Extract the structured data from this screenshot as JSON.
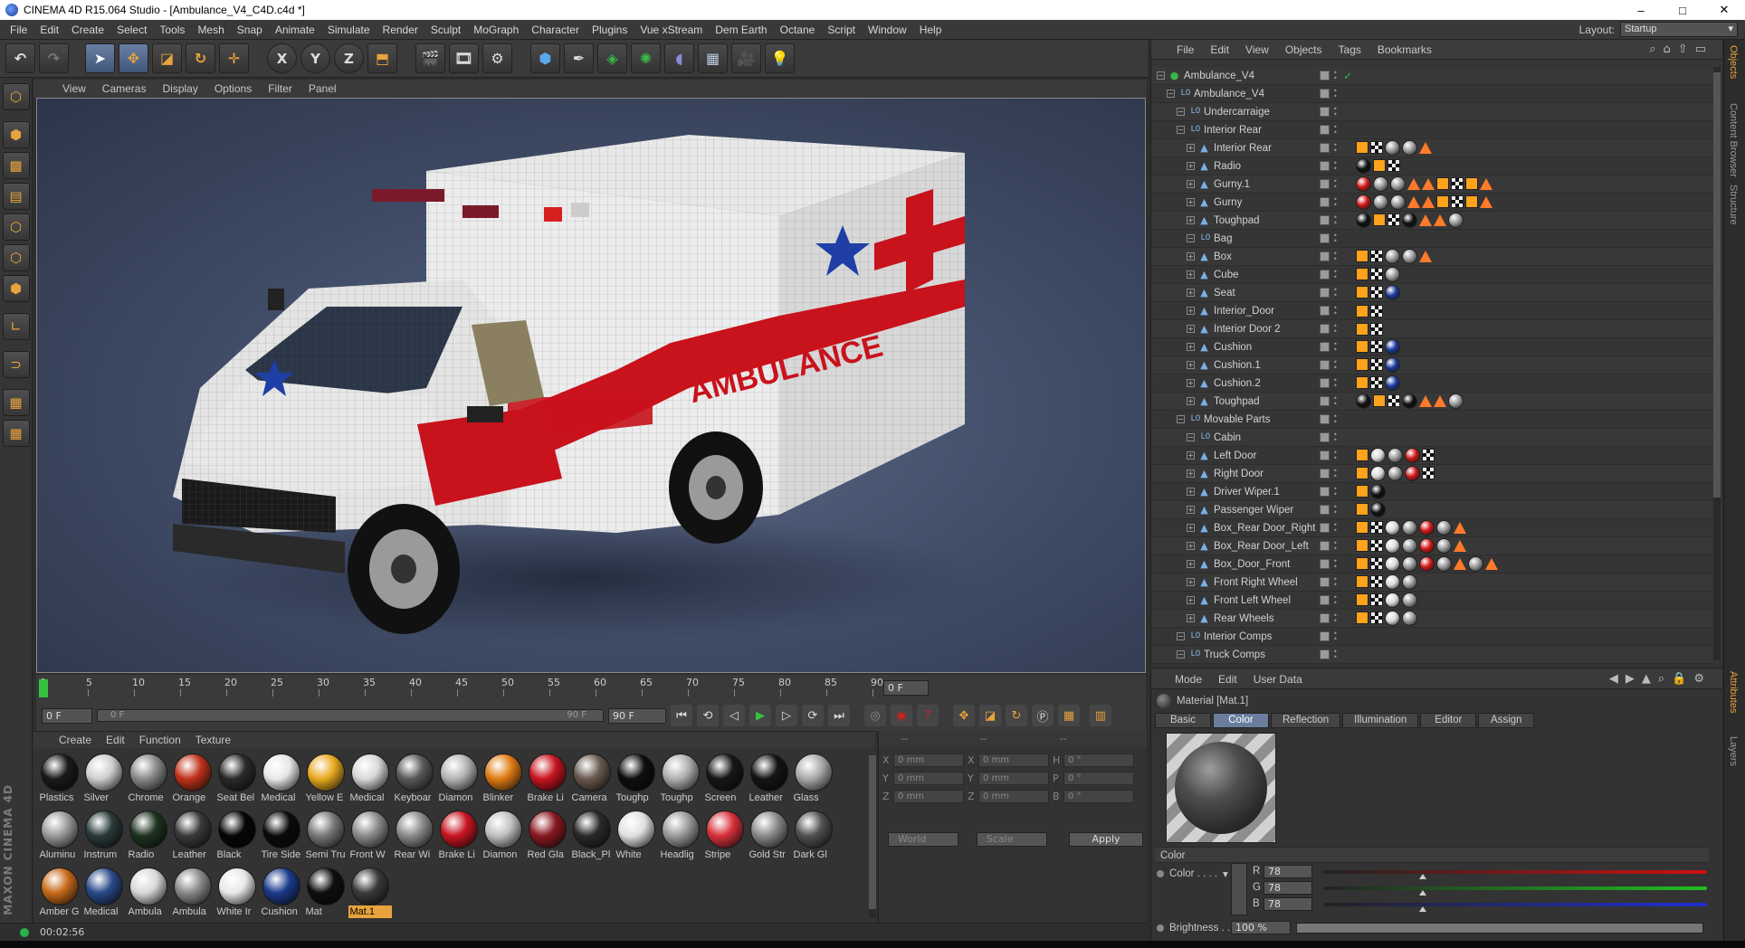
{
  "window": {
    "title": "CINEMA 4D R15.064 Studio - [Ambulance_V4_C4D.c4d *]",
    "minimize": "–",
    "maximize": "□",
    "close": "✕"
  },
  "menubar": {
    "items": [
      "File",
      "Edit",
      "Create",
      "Select",
      "Tools",
      "Mesh",
      "Snap",
      "Animate",
      "Simulate",
      "Render",
      "Sculpt",
      "MoGraph",
      "Character",
      "Plugins",
      "Vue xStream",
      "Dem Earth",
      "Octane",
      "Script",
      "Window",
      "Help"
    ],
    "layout_label": "Layout:",
    "layout_value": "Startup"
  },
  "viewport": {
    "menu": [
      "View",
      "Cameras",
      "Display",
      "Options",
      "Filter",
      "Panel"
    ]
  },
  "timeline": {
    "ticks": [
      "0",
      "5",
      "10",
      "15",
      "20",
      "25",
      "30",
      "35",
      "40",
      "45",
      "50",
      "55",
      "60",
      "65",
      "70",
      "75",
      "80",
      "85",
      "90"
    ],
    "current_frame": "0 F",
    "start_field": "0 F",
    "range_start": "0 F",
    "range_end": "90 F",
    "end_field": "90 F"
  },
  "materials": {
    "menu": [
      "Create",
      "Edit",
      "Function",
      "Texture"
    ],
    "items": [
      {
        "label": "Plastics",
        "color": "#1a1a1a"
      },
      {
        "label": "Silver",
        "color": "#cfcfcf"
      },
      {
        "label": "Chrome",
        "color": "#8a8a8a"
      },
      {
        "label": "Orange",
        "color": "#c0321a"
      },
      {
        "label": "Seat Bel",
        "color": "#2a2a2a"
      },
      {
        "label": "Medical",
        "color": "#e8e8e8"
      },
      {
        "label": "Yellow E",
        "color": "#e8a91f"
      },
      {
        "label": "Medical",
        "color": "#d8d8d8"
      },
      {
        "label": "Keyboar",
        "color": "#5a5a5a"
      },
      {
        "label": "Diamon",
        "color": "#b5b5b5"
      },
      {
        "label": "Blinker",
        "color": "#e07c14"
      },
      {
        "label": "Brake Li",
        "color": "#c8141e"
      },
      {
        "label": "Camera",
        "color": "#6a5a50"
      },
      {
        "label": "Toughp",
        "color": "#0e0e0e"
      },
      {
        "label": "Toughp",
        "color": "#b0b0b0"
      },
      {
        "label": "Screen",
        "color": "#161616"
      },
      {
        "label": "Leather",
        "color": "#141414"
      },
      {
        "label": "Glass",
        "color": "#aaaaaa"
      },
      {
        "label": "Aluminu",
        "color": "#9a9a9a"
      },
      {
        "label": "Instrum",
        "color": "#2a3a3a"
      },
      {
        "label": "Radio",
        "color": "#1e3320"
      },
      {
        "label": "Leather",
        "color": "#3a3a3a"
      },
      {
        "label": "Black",
        "color": "#050505"
      },
      {
        "label": "Tire Side",
        "color": "#0a0a0a"
      },
      {
        "label": "Semi Tru",
        "color": "#777777"
      },
      {
        "label": "Front W",
        "color": "#8a8a8a"
      },
      {
        "label": "Rear Wi",
        "color": "#8a8a8a"
      },
      {
        "label": "Brake Li",
        "color": "#c81420"
      },
      {
        "label": "Diamon",
        "color": "#c0c0c0"
      },
      {
        "label": "Red Gla",
        "color": "#8a1820"
      },
      {
        "label": "Black_Pl",
        "color": "#2a2a2a"
      },
      {
        "label": "White",
        "color": "#e0e0e0"
      },
      {
        "label": "Headlig",
        "color": "#9a9a9a"
      },
      {
        "label": "Stripe",
        "color": "#d8303a"
      },
      {
        "label": "Gold Str",
        "color": "#8a8a8a"
      },
      {
        "label": "Dark Gl",
        "color": "#505050"
      },
      {
        "label": "Amber G",
        "color": "#c86a1a"
      },
      {
        "label": "Medical",
        "color": "#2a4a8a"
      },
      {
        "label": "Ambula",
        "color": "#d8d8d8"
      },
      {
        "label": "Ambula",
        "color": "#8a8a8a"
      },
      {
        "label": "White Ir",
        "color": "#e8e8e8"
      },
      {
        "label": "Cushion",
        "color": "#1a3a8a"
      },
      {
        "label": "Mat",
        "color": "#0e0e0e"
      },
      {
        "label": "Mat.1",
        "color": "#3a3a3a",
        "selected": true
      }
    ]
  },
  "coords": {
    "headers": [
      "--",
      "--",
      "--"
    ],
    "rows": [
      {
        "a": "X",
        "av": "0 mm",
        "b": "X",
        "bv": "0 mm",
        "c": "H",
        "cv": "0 °"
      },
      {
        "a": "Y",
        "av": "0 mm",
        "b": "Y",
        "bv": "0 mm",
        "c": "P",
        "cv": "0 °"
      },
      {
        "a": "Z",
        "av": "0 mm",
        "b": "Z",
        "bv": "0 mm",
        "c": "B",
        "cv": "0 °"
      }
    ],
    "mode1": "World",
    "mode2": "Scale",
    "apply": "Apply"
  },
  "status": {
    "time": "00:02:56"
  },
  "objects": {
    "menu": [
      "File",
      "Edit",
      "View",
      "Objects",
      "Tags",
      "Bookmarks"
    ],
    "rows": [
      {
        "name": "Ambulance_V4",
        "level": 0,
        "icon": "scene",
        "tags": ""
      },
      {
        "name": "Ambulance_V4",
        "level": 1,
        "icon": "null",
        "tags": ""
      },
      {
        "name": "Undercarraige",
        "level": 2,
        "icon": "null",
        "tags": ""
      },
      {
        "name": "Interior Rear",
        "level": 2,
        "icon": "null",
        "tags": ""
      },
      {
        "name": "Interior Rear",
        "level": 3,
        "icon": "poly",
        "tags": "uv chk mat mat tri"
      },
      {
        "name": "Radio",
        "level": 3,
        "icon": "poly",
        "tags": "black uv chk"
      },
      {
        "name": "Gurny.1",
        "level": 3,
        "icon": "poly",
        "tags": "red mat mat tri tri uv chk uv tri"
      },
      {
        "name": "Gurny",
        "level": 3,
        "icon": "poly",
        "tags": "red mat mat tri tri uv chk uv tri"
      },
      {
        "name": "Toughpad",
        "level": 3,
        "icon": "poly",
        "tags": "black uv chk black tri tri mat"
      },
      {
        "name": "Bag",
        "level": 3,
        "icon": "null",
        "tags": ""
      },
      {
        "name": "Box",
        "level": 3,
        "icon": "poly",
        "tags": "uv chk mat mat tri"
      },
      {
        "name": "Cube",
        "level": 3,
        "icon": "poly",
        "tags": "uv chk mat"
      },
      {
        "name": "Seat",
        "level": 3,
        "icon": "poly",
        "tags": "uv chk blue"
      },
      {
        "name": "Interior_Door",
        "level": 3,
        "icon": "poly",
        "tags": "uv chk"
      },
      {
        "name": "Interior Door 2",
        "level": 3,
        "icon": "poly",
        "tags": "uv chk"
      },
      {
        "name": "Cushion",
        "level": 3,
        "icon": "poly",
        "tags": "uv chk blue"
      },
      {
        "name": "Cushion.1",
        "level": 3,
        "icon": "poly",
        "tags": "uv chk blue"
      },
      {
        "name": "Cushion.2",
        "level": 3,
        "icon": "poly",
        "tags": "uv chk blue"
      },
      {
        "name": "Toughpad",
        "level": 3,
        "icon": "poly",
        "tags": "black uv chk black tri tri mat"
      },
      {
        "name": "Movable Parts",
        "level": 2,
        "icon": "null",
        "tags": ""
      },
      {
        "name": "Cabin",
        "level": 3,
        "icon": "null",
        "tags": ""
      },
      {
        "name": "Left Door",
        "level": 3,
        "icon": "poly",
        "tags": "uv white mat red chk"
      },
      {
        "name": "Right Door",
        "level": 3,
        "icon": "poly",
        "tags": "uv white mat red chk"
      },
      {
        "name": "Driver Wiper.1",
        "level": 3,
        "icon": "poly",
        "tags": "uv black"
      },
      {
        "name": "Passenger Wiper",
        "level": 3,
        "icon": "poly",
        "tags": "uv black"
      },
      {
        "name": "Box_Rear Door_Right",
        "level": 3,
        "icon": "poly",
        "tags": "uv chk white mat red mat tri"
      },
      {
        "name": "Box_Rear Door_Left",
        "level": 3,
        "icon": "poly",
        "tags": "uv chk white mat red mat tri"
      },
      {
        "name": "Box_Door_Front",
        "level": 3,
        "icon": "poly",
        "tags": "uv chk white mat red mat tri mat tri"
      },
      {
        "name": "Front Right Wheel",
        "level": 3,
        "icon": "poly",
        "tags": "uv chk white mat"
      },
      {
        "name": "Front Left Wheel",
        "level": 3,
        "icon": "poly",
        "tags": "uv chk white mat"
      },
      {
        "name": "Rear Wheels",
        "level": 3,
        "icon": "poly",
        "tags": "uv chk white mat"
      },
      {
        "name": "Interior Comps",
        "level": 2,
        "icon": "null",
        "tags": ""
      },
      {
        "name": "Truck Comps",
        "level": 2,
        "icon": "null",
        "tags": ""
      }
    ]
  },
  "side_tabs": [
    "Objects",
    "Content Browser",
    "Structure",
    "Attributes",
    "Layers"
  ],
  "attributes": {
    "menu": [
      "Mode",
      "Edit",
      "User Data"
    ],
    "title": "Material [Mat.1]",
    "tabs": [
      "Basic",
      "Color",
      "Reflection",
      "Illumination",
      "Editor",
      "Assign"
    ],
    "active_tab": "Color",
    "section": "Color",
    "color_label": "Color . . . .",
    "r_label": "R",
    "r_value": "78",
    "g_label": "G",
    "g_value": "78",
    "b_label": "B",
    "b_value": "78",
    "brightness_label": "Brightness . .",
    "brightness_value": "100 %"
  }
}
